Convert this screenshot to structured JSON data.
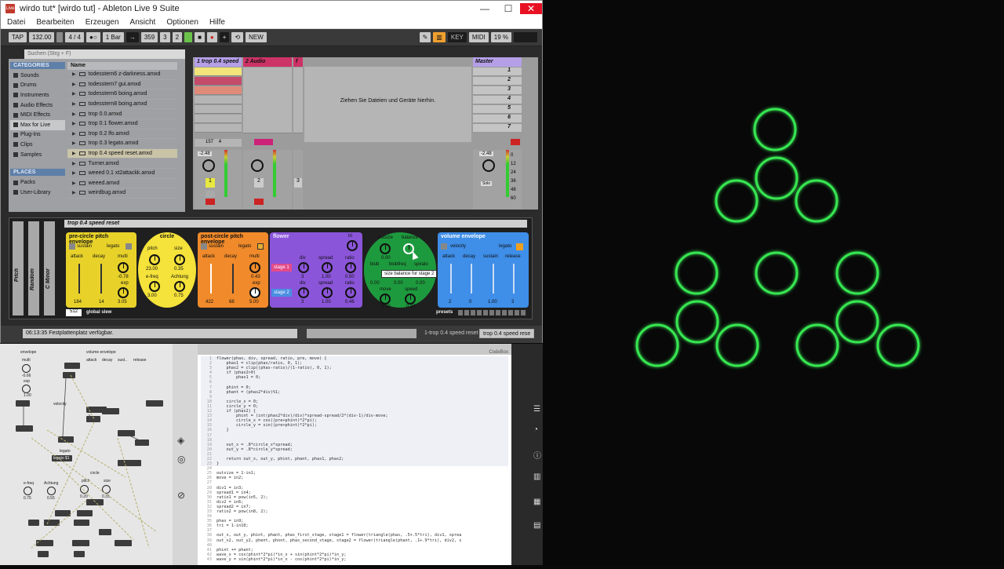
{
  "window": {
    "title": "wirdo tut*  [wirdo tut] - Ableton Live 9 Suite",
    "app_icon_text": "Live",
    "minimize": "—",
    "maximize": "☐",
    "close": "✕"
  },
  "menu": [
    "Datei",
    "Bearbeiten",
    "Erzeugen",
    "Ansicht",
    "Optionen",
    "Hilfe"
  ],
  "transport": {
    "tap": "TAP",
    "tempo": "132.00",
    "signature": "4 / 4",
    "metro": "1 Bar",
    "position": [
      "359",
      "3",
      "2"
    ],
    "new": "NEW",
    "key": "KEY",
    "midi": "MIDI",
    "cpu": "19 %"
  },
  "browser": {
    "search_placeholder": "Suchen (Strg + F)",
    "categories_title": "CATEGORIES",
    "categories": [
      "Sounds",
      "Drums",
      "Instruments",
      "Audio Effects",
      "MIDI Effects",
      "Max for Live",
      "Plug-Ins",
      "Clips",
      "Samples"
    ],
    "places_title": "PLACES",
    "places": [
      "Packs",
      "User-Library"
    ],
    "name_header": "Name",
    "files": [
      "todesstern6 z-darkness.amxd",
      "todesstern7 gui.amxd",
      "todesstern6 boing.amxd",
      "todesstern8 boing.amxd",
      "trop 0.0.amxd",
      "trop 0.1 flower.amxd",
      "trop 0.2 lfo.amxd",
      "trop 0.3 legato.amxd",
      "trop 0.4 speed reset.amxd",
      "Turner.amxd",
      "weeed 0.1 xt2attackk.amxd",
      "weeed.amxd",
      "weirdbug.amxd"
    ]
  },
  "session": {
    "tracks": [
      {
        "name": "1 trop 0.4 speed",
        "color": "#b5a0e8"
      },
      {
        "name": "2 Audio",
        "color": "#cc3366"
      },
      {
        "name": "f",
        "color": "#cc3366"
      }
    ],
    "master": "Master",
    "drop_hint": "Ziehen Sie Dateien und Geräte hierhin.",
    "scenes": [
      "1",
      "2",
      "3",
      "4",
      "5",
      "6",
      "7"
    ],
    "track1_volume": "-2.48",
    "track1_number": "1",
    "track2_number": "2",
    "track3_number": "3",
    "master_volume": "-2.48",
    "solo": "Solo",
    "scale": [
      "0",
      "12",
      "24",
      "36",
      "48",
      "60"
    ],
    "track1_send_a": "157",
    "track1_send_b": "4"
  },
  "device": {
    "title": "trop 0.4 speed reset",
    "side_labels": [
      "Pitch",
      "Random",
      "C Minor"
    ],
    "pre": {
      "title": "pre-circle pitch envelope",
      "sustain": "sustain",
      "legato": "legato",
      "attack": "attack",
      "decay": "decay",
      "multi": "multi",
      "multi_val": "-0.78",
      "exp": "exp",
      "exp_val": "3.05",
      "attack_val": "184",
      "decay_val": "14"
    },
    "circle": {
      "title": "circle",
      "pitch": "pitch",
      "pitch_val": "23.00",
      "size": "size",
      "size_val": "0.35",
      "efreq": "e-freq",
      "efreq_val": "3.00",
      "achtung": "Achtung",
      "achtung_val": "0.75"
    },
    "post": {
      "title": "post-circle pitch envelope",
      "sustain": "sustain",
      "legato": "legato",
      "attack": "attack",
      "decay": "decay",
      "multi": "multi",
      "multi_val": "0.43",
      "exp": "exp",
      "exp_val": "5.00",
      "attack_val": "422",
      "decay_val": "68"
    },
    "flower": {
      "title": "flower",
      "tri": "tri",
      "stage1": "stage 1",
      "stage2": "stage 2",
      "div": "div",
      "spread": "spread",
      "ratio": "ratio",
      "div1_val": "3",
      "spread1_val": "1.00",
      "ratio1_val": "0.50",
      "div2_val": "3",
      "spread2_val": "1.00",
      "ratio2_val": "0.46"
    },
    "green": {
      "outsize": "outsize",
      "balance": "balance",
      "outsize_val": "0.00",
      "blub": "blub",
      "blubfreq": "blubfreq",
      "spiralo": "spiralo",
      "blub_val": "0.00",
      "blubfreq_val": "0.00",
      "spiralo_val": "0.00",
      "move": "move",
      "speed": "speed",
      "move_val": "0.00",
      "speed_val": "0.00",
      "tooltip": "size balance for stage 2"
    },
    "volume": {
      "title": "volume envelope",
      "velocity": "velocity",
      "legato": "legato",
      "attack": "attack",
      "decay": "decay",
      "sustain": "sustain",
      "release": "release",
      "attack_val": "2",
      "decay_val": "0",
      "sustain_val": "1.00",
      "release_val": "3"
    },
    "presets": "presets",
    "slew_val": "512",
    "slew": "global slew"
  },
  "status": {
    "message": "06:13:35 Festplattenplatz verfügbar.",
    "track_label": "1-trop 0.4 speed reset",
    "device_label": "trop 0.4 speed rese"
  },
  "max_patch": {
    "labels": [
      "envelope",
      "volume envelope",
      "multi",
      "attack",
      "decay",
      "sust..",
      "release",
      "velocity",
      "legato",
      "legato $1",
      "exp",
      "circle",
      "e-freq",
      "Achtung",
      "pitch",
      "size"
    ],
    "values": [
      "-0.66",
      "1.00",
      "0.75",
      "0.00",
      "0.00",
      "0.00",
      "0.00",
      "0.55",
      "0.20",
      "0.35"
    ]
  },
  "codebox": {
    "title": "CodeBox",
    "lines": [
      "flower(phas, div, spread, ratio, pre, move) {",
      "    phas1 = clip(phas/ratio, 0, 1);",
      "    phas2 = clip((phas-ratio)/(1-ratio), 0, 1);",
      "    if (phas2>0)",
      "        phas1 = 0;",
      "",
      "    phint = 0;",
      "    phant = (phas2*div)%1;",
      "",
      "    circle_x = 0;",
      "    circle_y = 0;",
      "    if (phas2) {",
      "        phint = (int(phas2*div)/div)*spread-spread/2*(div-1)/div-move;",
      "        circle_x = cos((pre+phint)*2*pi);",
      "        circle_y = sin((pre+phint)*2*pi);",
      "    }",
      "",
      "",
      "    out_x = .8*circle_x*spread;",
      "    out_y = .8*circle_y*spread;",
      "",
      "    return out_x, out_y, phint, phant, phas1, phas2;",
      "}",
      "",
      "outsize = 1-in1;",
      "move = in2;",
      "",
      "div1 = in3;",
      "spread1 = in4;",
      "ratio1 = pow(in5, 2);",
      "div2 = in6;",
      "spread2 = in7;",
      "ratio2 = pow(in8, 2);",
      "",
      "phas = in9;",
      "tri = 1-in10;",
      "",
      "out_x, out_y, phint, phant, phas_first_stage, stage1 = flower(triangle(phas, .5+.5*tri), div1, sprea",
      "out_x2, out_y2, phent, phont, phas_second_stage, stage2 = flower(triangle(phant, .1+.9*tri), div2, s",
      "",
      "phint += phant;",
      "wave_x = cos(phint*2*pi)*in_x + sin(phint*2*pi)*in_y;",
      "wave_y = sin(phint*2*pi)*in_x - cos(phint*2*pi)*in_y;"
    ]
  },
  "colors": {
    "pre_panel": "#e8d22a",
    "circle_panel": "#f5e23a",
    "post_panel": "#f08a2a",
    "flower_panel": "#8b55d9",
    "green_panel": "#1e9a3e",
    "volume_panel": "#3f8ee8",
    "osc_green": "#3cff5a"
  }
}
